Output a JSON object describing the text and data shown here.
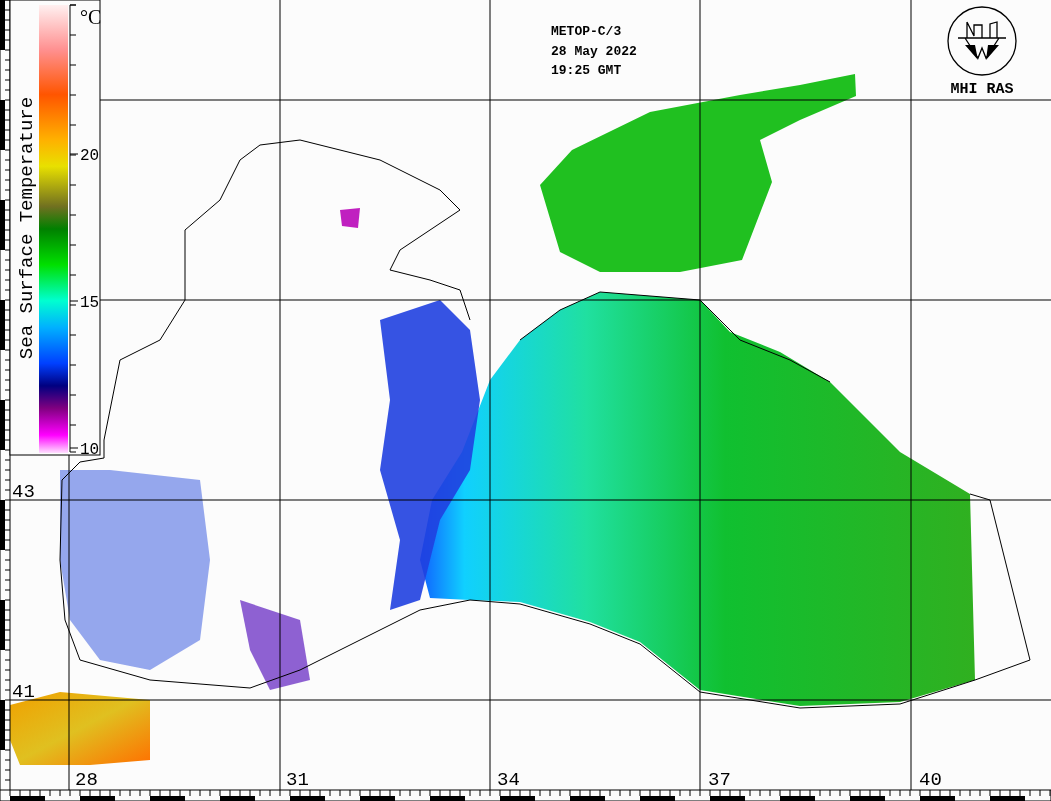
{
  "title_lines": [
    "METOP-C/3",
    "28 May 2022",
    "19:25 GMT"
  ],
  "logo": {
    "text": "MHI RAS"
  },
  "legend": {
    "label": "Sea Surface Temperature",
    "unit": "°C",
    "ticks": [
      "20",
      "15",
      "10"
    ]
  },
  "latitude_labels": [
    "43",
    "41"
  ],
  "longitude_labels": [
    "28",
    "31",
    "34",
    "37",
    "40"
  ]
}
